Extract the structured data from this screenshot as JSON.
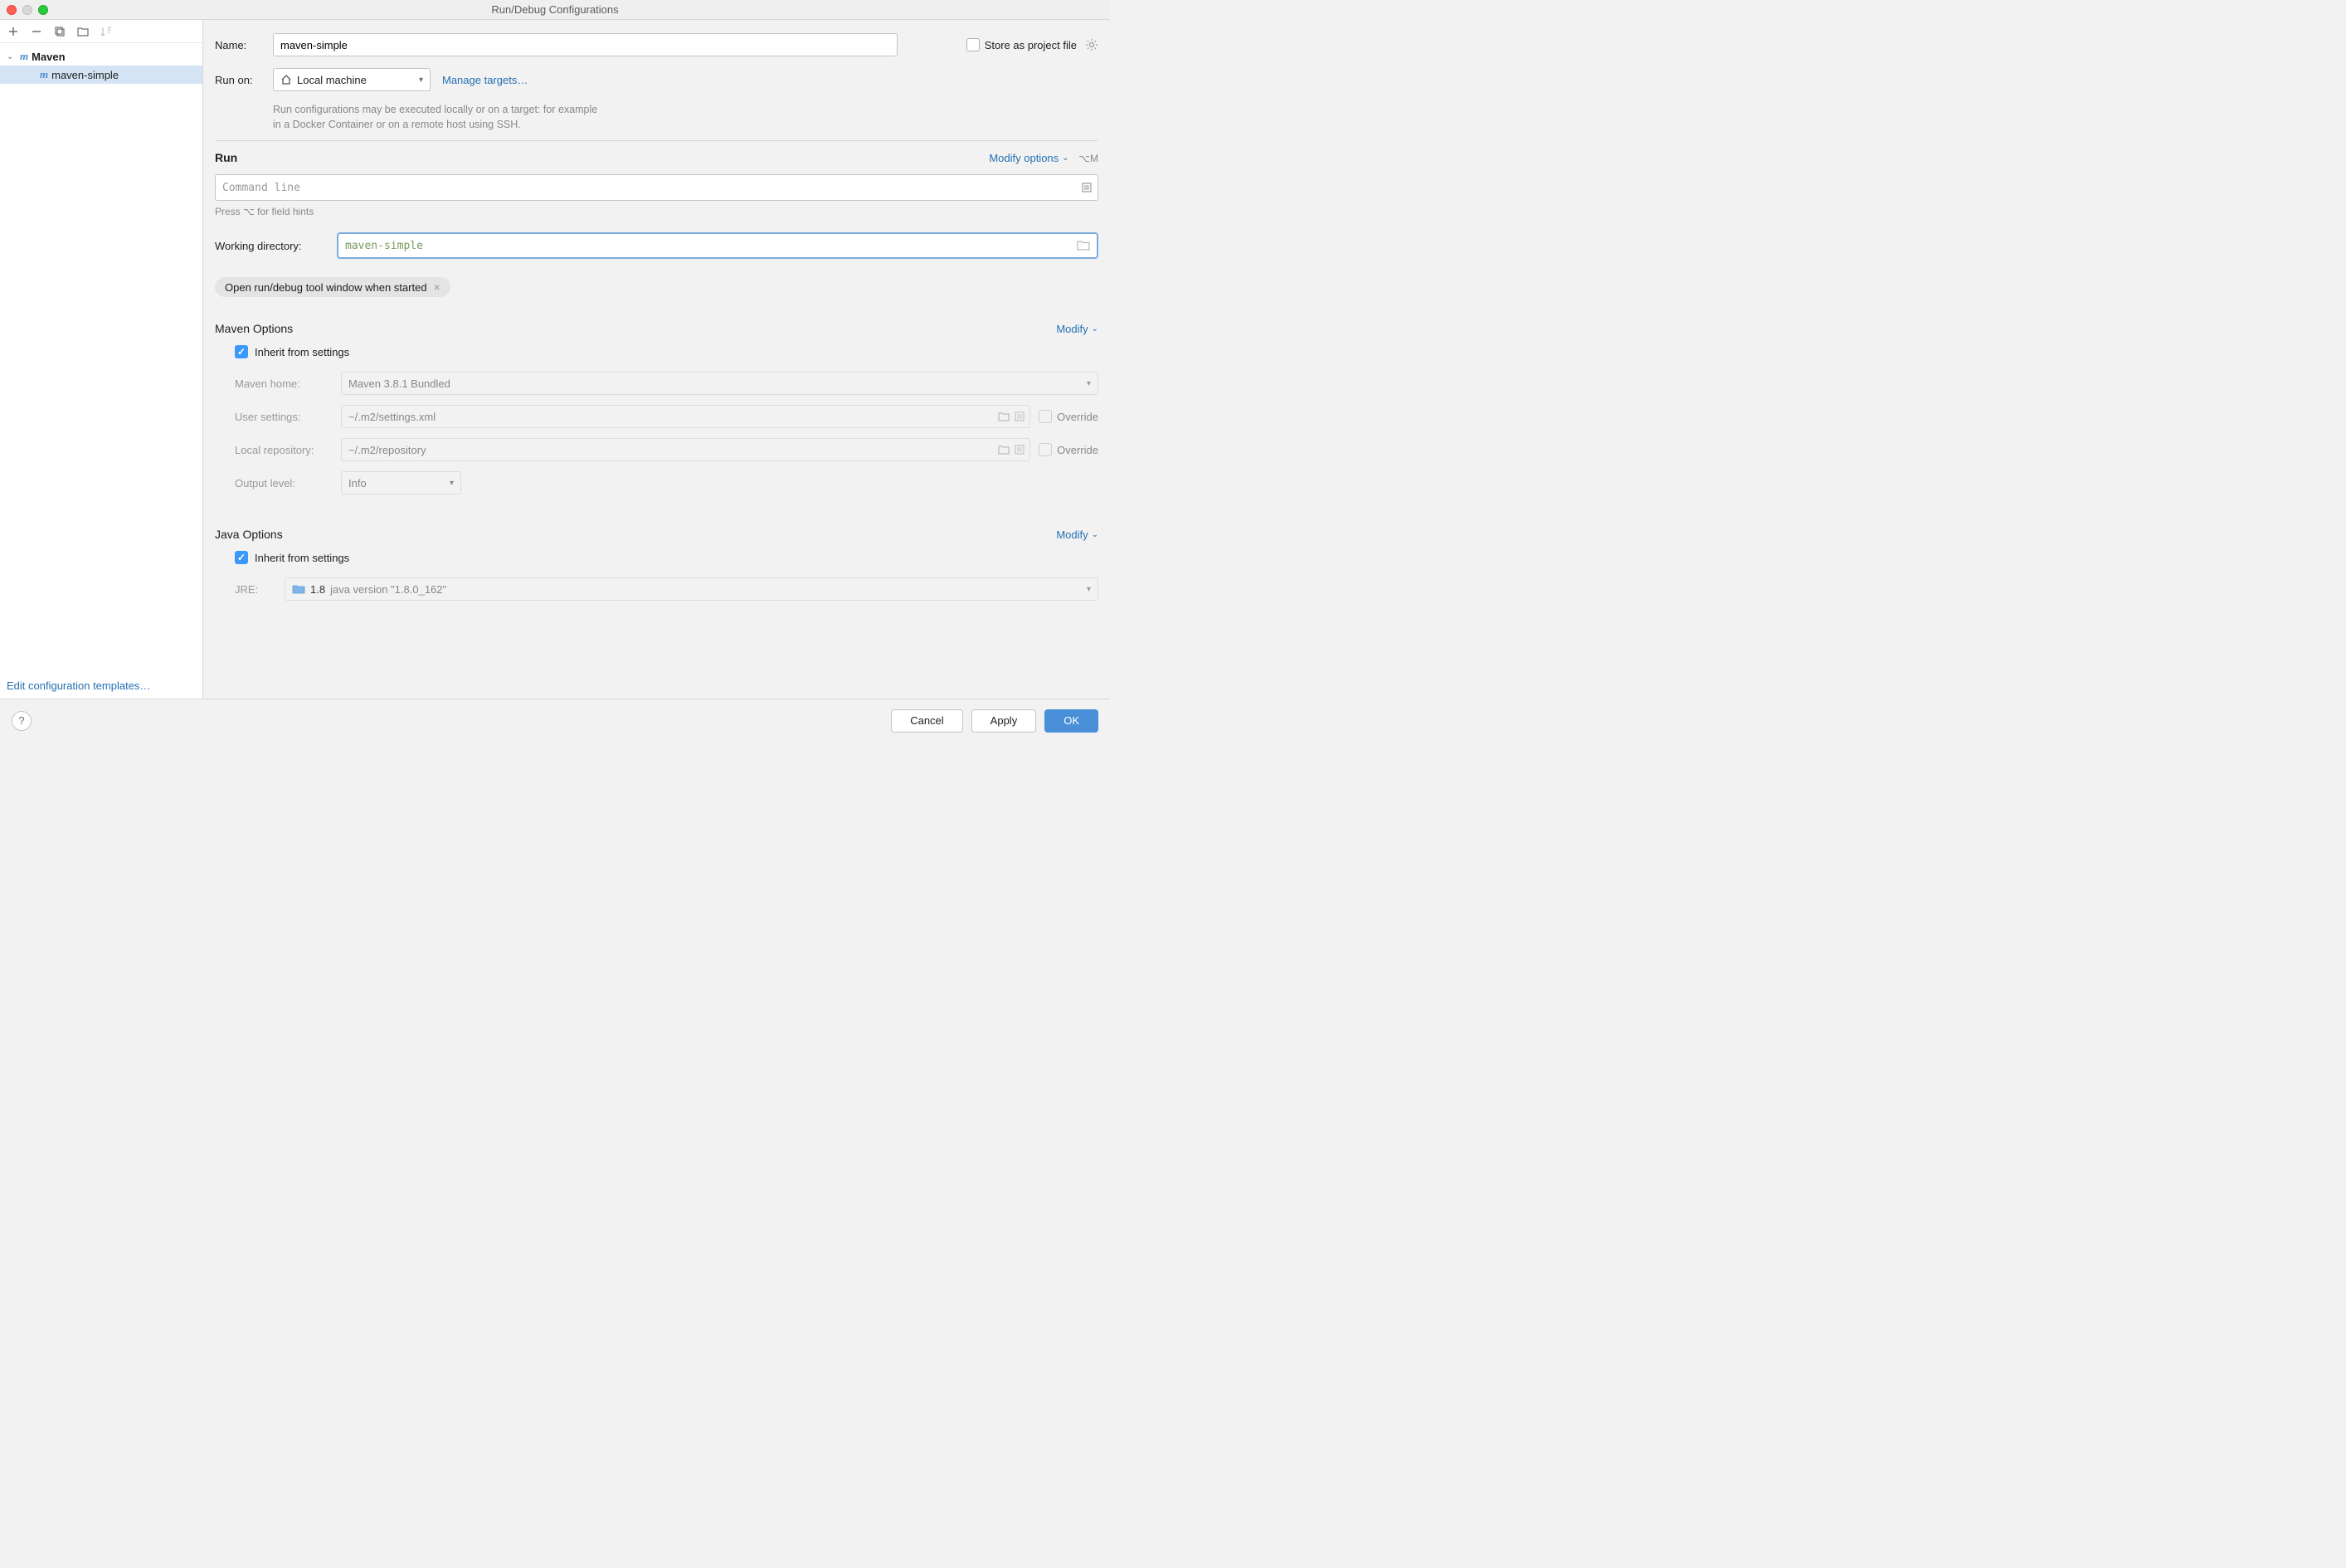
{
  "window": {
    "title": "Run/Debug Configurations"
  },
  "sidebar": {
    "root_label": "Maven",
    "child_label": "maven-simple",
    "edit_templates": "Edit configuration templates…"
  },
  "form": {
    "name_label": "Name:",
    "name_value": "maven-simple",
    "store_label": "Store as project file",
    "runon_label": "Run on:",
    "runon_value": "Local machine",
    "manage_targets": "Manage targets…",
    "runon_help1": "Run configurations may be executed locally or on a target: for example",
    "runon_help2": "in a Docker Container or on a remote host using SSH."
  },
  "run": {
    "title": "Run",
    "modify": "Modify options",
    "shortcut": "⌥M",
    "cmdline_placeholder": "Command line",
    "hint": "Press ⌥ for field hints",
    "wd_label": "Working directory:",
    "wd_value": "maven-simple",
    "chip": "Open run/debug tool window when started"
  },
  "maven": {
    "title": "Maven Options",
    "modify": "Modify",
    "inherit": "Inherit from settings",
    "home_label": "Maven home:",
    "home_value": "Maven 3.8.1 Bundled",
    "user_label": "User settings:",
    "user_value": "~/.m2/settings.xml",
    "repo_label": "Local repository:",
    "repo_value": "~/.m2/repository",
    "output_label": "Output level:",
    "output_value": "Info",
    "override": "Override"
  },
  "java": {
    "title": "Java Options",
    "modify": "Modify",
    "inherit": "Inherit from settings",
    "jre_label": "JRE:",
    "jre_version": "1.8",
    "jre_desc": "java version \"1.8.0_162\""
  },
  "footer": {
    "cancel": "Cancel",
    "apply": "Apply",
    "ok": "OK"
  }
}
